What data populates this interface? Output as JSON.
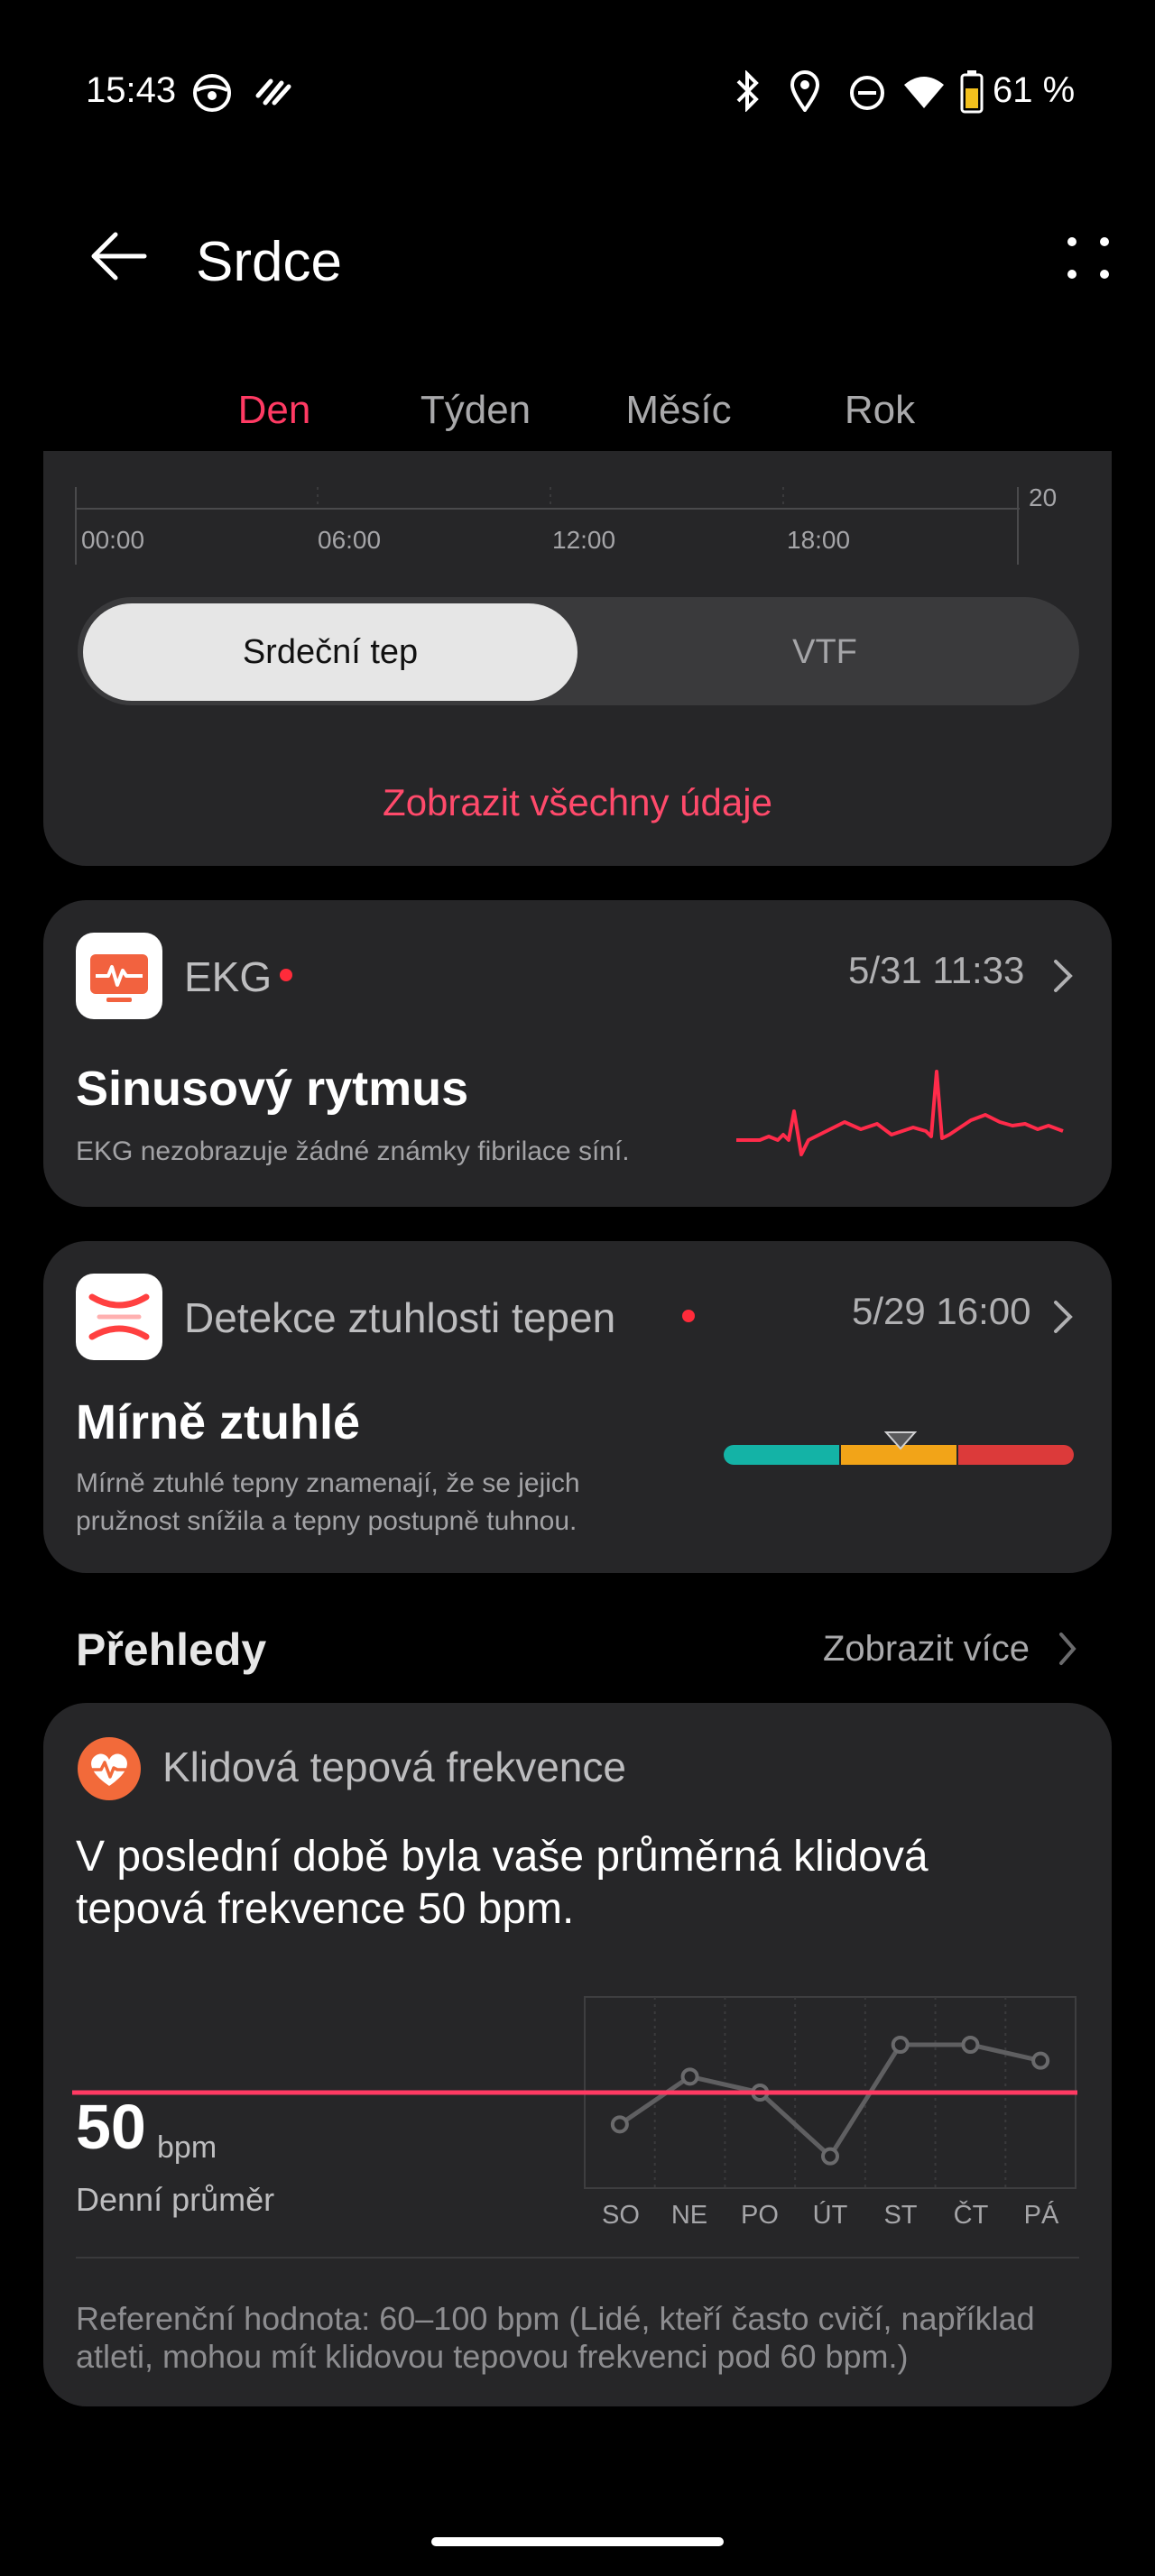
{
  "status_bar": {
    "time": "15:43",
    "battery": "61 %"
  },
  "header": {
    "title": "Srdce"
  },
  "tabs": [
    {
      "label": "Den"
    },
    {
      "label": "Týden"
    },
    {
      "label": "Měsíc"
    },
    {
      "label": "Rok"
    }
  ],
  "active_tab": "Den",
  "chart_top": {
    "time_ticks": [
      "00:00",
      "06:00",
      "12:00",
      "18:00"
    ],
    "axis_label": "20"
  },
  "segment": {
    "options": [
      "Srdeční tep",
      "VTF"
    ],
    "selected": "Srdeční tep"
  },
  "show_all_link": "Zobrazit všechny údaje",
  "ekg": {
    "title": "EKG",
    "time": "5/31 11:33",
    "result": "Sinusový rytmus",
    "desc": "EKG nezobrazuje žádné známky fibrilace síní."
  },
  "artery": {
    "title": "Detekce ztuhlosti tepen",
    "time": "5/29 16:00",
    "result": "Mírně ztuhlé",
    "desc_line1": "Mírně ztuhlé tepny znamenají, že se jejich",
    "desc_line2": "pružnost snížila a tepny postupně tuhnou."
  },
  "overviews": {
    "title": "Přehledy",
    "more": "Zobrazit více"
  },
  "resting_hr": {
    "title": "Klidová tepová frekvence",
    "insight_line1": "V poslední době byla vaše průměrná klidová",
    "insight_line2": "tepová frekvence 50 bpm.",
    "value": "50",
    "unit": "bpm",
    "avg_label": "Denní průměr",
    "reference_line1": "Referenční hodnota: 60–100 bpm (Lidé, kteří často cvičí, například",
    "reference_line2": "atleti, mohou mít klidovou tepovou frekvenci pod 60 bpm.)"
  },
  "colors": {
    "accent": "#ff3a63",
    "card": "#262628",
    "background": "#000000"
  },
  "chart_data": {
    "type": "line",
    "categories": [
      "SO",
      "NE",
      "PO",
      "ÚT",
      "ST",
      "ČT",
      "PÁ"
    ],
    "series": [
      {
        "values": [
          48,
          51,
          50,
          46,
          53,
          53,
          52
        ]
      }
    ],
    "reference_line": 50
  }
}
